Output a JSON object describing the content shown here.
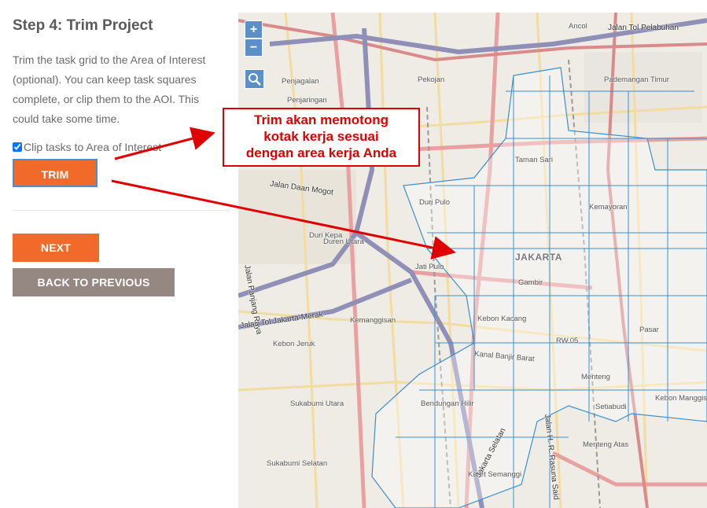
{
  "step_title": "Step 4: Trim Project",
  "description": "Trim the task grid to the Area of Interest (optional). You can keep task squares complete, or clip them to the AOI. This could take some time.",
  "clip_checkbox": {
    "label": "Clip tasks to Area of Interest",
    "checked": true
  },
  "buttons": {
    "trim": "TRIM",
    "next": "NEXT",
    "back": "BACK TO PREVIOUS"
  },
  "map": {
    "zoom_in": "+",
    "zoom_out": "−",
    "labels": {
      "jalan_tol_pelabuhan": "Jalan Tol Pelabuhan",
      "ancol": "Ancol",
      "pademangan_timur": "Pademangan Timur",
      "penjagalan": "Penjagalan",
      "pekojan": "Pekojan",
      "penjaringan": "Penjaringan",
      "taman_sari": "Taman Sari",
      "jalan_daan_mogot": "Jalan Daan Mogot",
      "duri_kepa": "Duri Kepa",
      "duren_utara": "Duren Utara",
      "jati_pulo": "Jati Pulo",
      "jakarta": "JAKARTA",
      "gambir": "Gambir",
      "kemayoran": "Kemayoran",
      "jalan_tol_jakarta_merak": "Jalan Tol Jakarta-Merak",
      "kemanggisan": "Kemanggisan",
      "kebon_kacang": "Kebon Kacang",
      "kebon_jeruk": "Kebon Jeruk",
      "kanal_banjir_barat": "Kanal Banjir Barat",
      "kebon_manggis": "Kebon Manggis",
      "setiabudi": "Setiabudi",
      "menteng": "Menteng",
      "menteng_atas": "Menteng Atas",
      "sukabumi_utara": "Sukabumi Utara",
      "sukabumi_selatan": "Sukabumi Selatan",
      "karet_semanggi": "Karet Semanggi",
      "jalan_panjang_raya": "Jalan Panjang Raya",
      "jalan_jakarta_selatan": "Jakarta Selatan",
      "jalan_rasuna_said": "Jalan H. R. Rasuna Said",
      "bendungan_hilir": "Bendungan Hilir",
      "pasar": "Pasar",
      "duri_pulo": "Duri Pulo",
      "rw05": "RW.05"
    }
  },
  "callout": {
    "lines": [
      "Trim akan memotong",
      "kotak kerja sesuai",
      "dengan area kerja Anda"
    ]
  }
}
